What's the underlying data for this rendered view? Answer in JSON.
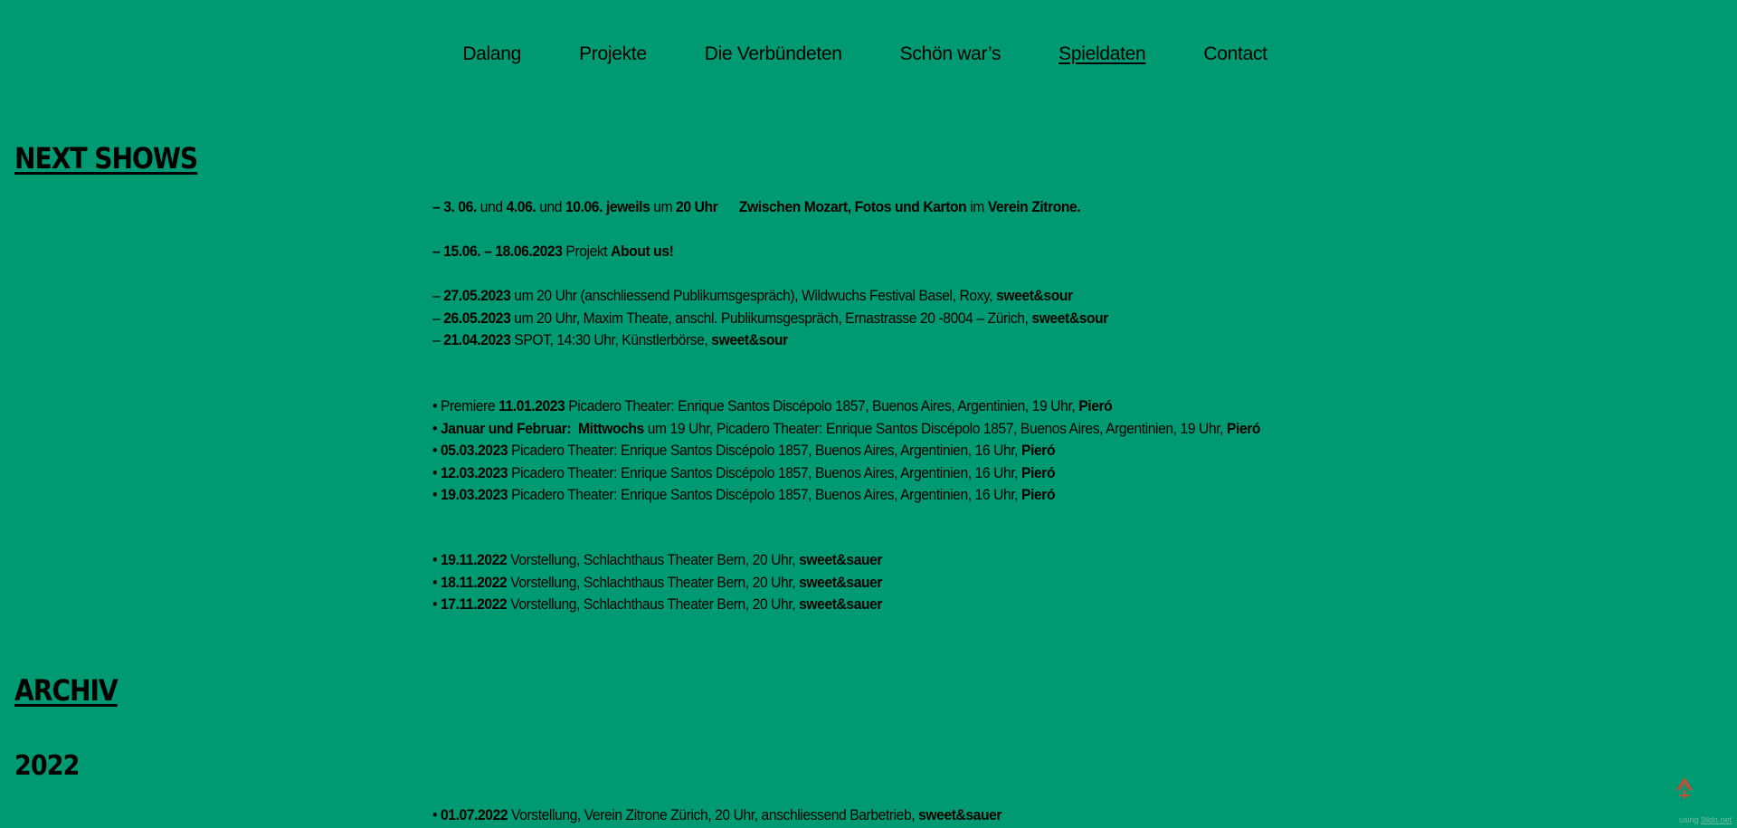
{
  "nav": {
    "items": [
      {
        "label": "Dalang",
        "active": false
      },
      {
        "label": "Projekte",
        "active": false
      },
      {
        "label": "Die Verbündeten",
        "active": false
      },
      {
        "label": "Schön war’s",
        "active": false
      },
      {
        "label": "Spieldaten",
        "active": true
      },
      {
        "label": "Contact",
        "active": false
      }
    ]
  },
  "sections": {
    "next_shows": "NEXT SHOWS",
    "archiv": "ARCHIV",
    "year_2022": "2022"
  },
  "next_shows": {
    "group1": [
      {
        "segments": [
          {
            "t": "– 3. 06.",
            "b": true
          },
          {
            "t": " und ",
            "b": false
          },
          {
            "t": "4.06.",
            "b": true
          },
          {
            "t": " und ",
            "b": false
          },
          {
            "t": "10.06. jeweils",
            "b": true
          },
          {
            "t": " um ",
            "b": false
          },
          {
            "t": "20 Uhr",
            "b": true
          },
          {
            "t": "      ",
            "b": false
          },
          {
            "t": "Zwischen Mozart, Fotos und Karton",
            "b": true
          },
          {
            "t": " im ",
            "b": false
          },
          {
            "t": "Verein Zitrone.",
            "b": true
          }
        ]
      }
    ],
    "group2": [
      {
        "segments": [
          {
            "t": "– 15.06. – 18.06.2023",
            "b": true
          },
          {
            "t": " Projekt ",
            "b": false
          },
          {
            "t": "About us!",
            "b": true
          }
        ]
      }
    ],
    "group3": [
      {
        "segments": [
          {
            "t": "– ",
            "b": false
          },
          {
            "t": "27.05.2023",
            "b": true
          },
          {
            "t": " um 20 Uhr (anschliessend Publikumsgespräch), Wildwuchs Festival Basel, Roxy, ",
            "b": false
          },
          {
            "t": "sweet&sour",
            "b": true
          }
        ]
      },
      {
        "segments": [
          {
            "t": "– ",
            "b": false
          },
          {
            "t": "26.05.2023",
            "b": true
          },
          {
            "t": " um 20 Uhr, Maxim Theate, anschl. Publikumsgespräch, Ernastrasse 20 -8004 – Zürich, ",
            "b": false
          },
          {
            "t": "sweet&sour",
            "b": true
          }
        ]
      },
      {
        "segments": [
          {
            "t": "– ",
            "b": false
          },
          {
            "t": "21.04.2023",
            "b": true
          },
          {
            "t": " SPOT, 14:30 Uhr, Künstlerbörse, ",
            "b": false
          },
          {
            "t": "sweet&sour",
            "b": true
          }
        ]
      }
    ],
    "group4": [
      {
        "segments": [
          {
            "t": "• Premiere ",
            "b": false
          },
          {
            "t": "11.01.2023",
            "b": true
          },
          {
            "t": " Picadero Theater: Enrique Santos Discépolo 1857, Buenos Aires, Argentinien, 19 Uhr, ",
            "b": false
          },
          {
            "t": "Pieró",
            "b": true
          }
        ]
      },
      {
        "segments": [
          {
            "t": "• ",
            "b": false
          },
          {
            "t": "Januar und Februar:  Mittwochs",
            "b": true
          },
          {
            "t": " um 19 Uhr, Picadero Theater: Enrique Santos Discépolo 1857, Buenos Aires, Argentinien, 19 Uhr, ",
            "b": false
          },
          {
            "t": "Pieró",
            "b": true
          }
        ]
      },
      {
        "segments": [
          {
            "t": "• ",
            "b": false
          },
          {
            "t": "05.03.2023",
            "b": true
          },
          {
            "t": " Picadero Theater: Enrique Santos Discépolo 1857, Buenos Aires, Argentinien, 16 Uhr, ",
            "b": false
          },
          {
            "t": "Pieró",
            "b": true
          }
        ]
      },
      {
        "segments": [
          {
            "t": "• ",
            "b": false
          },
          {
            "t": "12.03.2023",
            "b": true
          },
          {
            "t": " Picadero Theater: Enrique Santos Discépolo 1857, Buenos Aires, Argentinien, 16 Uhr, ",
            "b": false
          },
          {
            "t": "Pieró",
            "b": true
          }
        ]
      },
      {
        "segments": [
          {
            "t": "• ",
            "b": false
          },
          {
            "t": "19.03.2023",
            "b": true
          },
          {
            "t": " Picadero Theater: Enrique Santos Discépolo 1857, Buenos Aires, Argentinien, 16 Uhr, ",
            "b": false
          },
          {
            "t": "Pieró",
            "b": true
          }
        ]
      }
    ],
    "group5": [
      {
        "segments": [
          {
            "t": "• ",
            "b": false
          },
          {
            "t": "19.11.2022",
            "b": true
          },
          {
            "t": " Vorstellung, Schlachthaus Theater Bern, 20 Uhr, ",
            "b": false
          },
          {
            "t": "sweet&sauer",
            "b": true
          }
        ]
      },
      {
        "segments": [
          {
            "t": "• ",
            "b": false
          },
          {
            "t": "18.11.2022",
            "b": true
          },
          {
            "t": " Vorstellung, Schlachthaus Theater Bern, 20 Uhr, ",
            "b": false
          },
          {
            "t": "sweet&sauer",
            "b": true
          }
        ]
      },
      {
        "segments": [
          {
            "t": "• ",
            "b": false
          },
          {
            "t": "17.11.2022",
            "b": true
          },
          {
            "t": " Vorstellung, Schlachthaus Theater Bern, 20 Uhr, ",
            "b": false
          },
          {
            "t": "sweet&sauer",
            "b": true
          }
        ]
      }
    ]
  },
  "archiv_2022": [
    {
      "segments": [
        {
          "t": "• ",
          "b": false
        },
        {
          "t": "01.07.2022",
          "b": true
        },
        {
          "t": " Vorstellung, Verein Zitrone Zürich, 20 Uhr, anschliessend Barbetrieb, ",
          "b": false
        },
        {
          "t": "sweet&sauer",
          "b": true
        }
      ]
    }
  ],
  "scroll_top": {
    "icon": "arrow-up-icon",
    "color": "#e8412f"
  },
  "credit": {
    "prefix": "using ",
    "link": "9lido.net"
  },
  "colors": {
    "background": "#009a72",
    "text": "#000000"
  }
}
